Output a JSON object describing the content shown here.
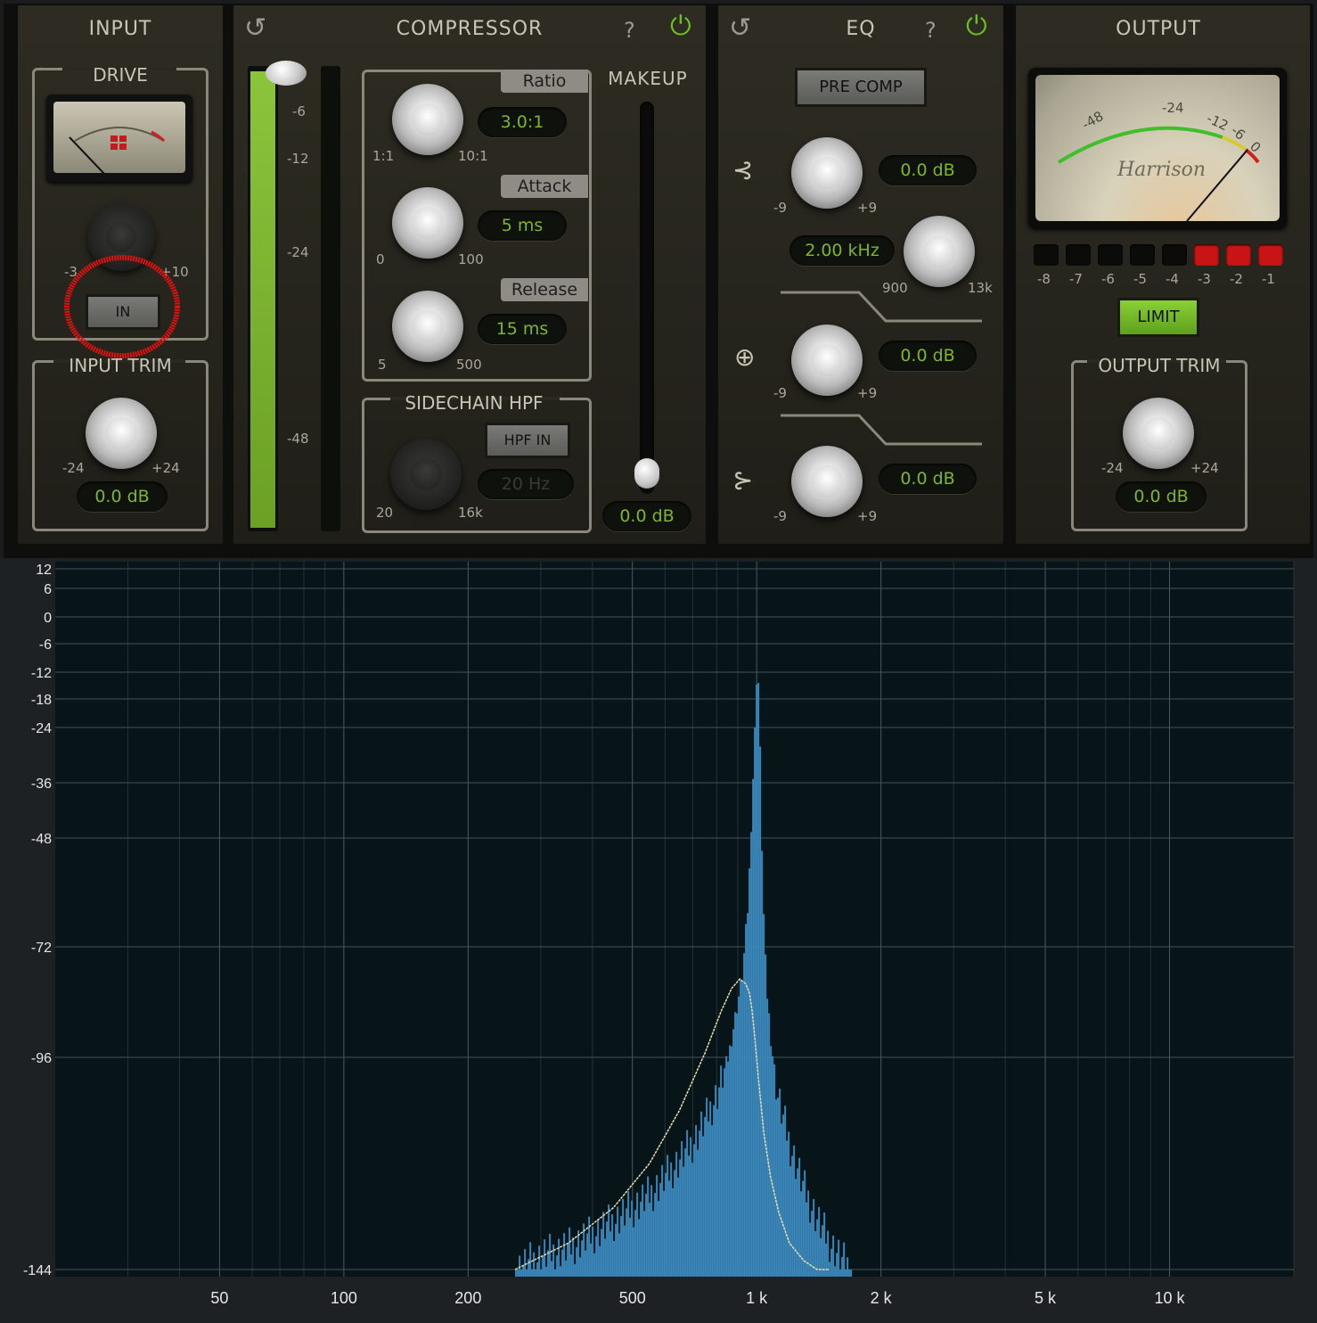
{
  "input": {
    "title": "INPUT",
    "drive_label": "DRIVE",
    "drive_min": "-3",
    "drive_max": "+10",
    "in_button": "IN",
    "trim_label": "INPUT TRIM",
    "trim_min": "-24",
    "trim_max": "+24",
    "trim_value": "0.0 dB"
  },
  "input_meter": {
    "scale": [
      "-6",
      "-12",
      "-24",
      "-48"
    ]
  },
  "compressor": {
    "title": "COMPRESSOR",
    "ratio_label": "Ratio",
    "ratio_value": "3.0:1",
    "ratio_min": "1:1",
    "ratio_max": "10:1",
    "attack_label": "Attack",
    "attack_value": "5 ms",
    "attack_min": "0",
    "attack_max": "100",
    "release_label": "Release",
    "release_value": "15 ms",
    "release_min": "5",
    "release_max": "500",
    "sidechain_label": "SIDECHAIN HPF",
    "hpf_button": "HPF IN",
    "hpf_value": "20 Hz",
    "hpf_min": "20",
    "hpf_max": "16k",
    "makeup_label": "MAKEUP",
    "makeup_value": "0.0 dB"
  },
  "eq": {
    "title": "EQ",
    "pre_comp_button": "PRE COMP",
    "band1_value": "0.0 dB",
    "band1_min": "-9",
    "band1_max": "+9",
    "freq_value": "2.00 kHz",
    "freq_min": "900",
    "freq_max": "13k",
    "band2_value": "0.0 dB",
    "band2_min": "-9",
    "band2_max": "+9",
    "band3_value": "0.0 dB",
    "band3_min": "-9",
    "band3_max": "+9"
  },
  "output": {
    "title": "OUTPUT",
    "vu_labels": [
      "-48",
      "-24",
      "-12",
      "-6",
      "0"
    ],
    "brand": "Harrison",
    "gr_leds": [
      "-8",
      "-7",
      "-6",
      "-5",
      "-4",
      "-3",
      "-2",
      "-1"
    ],
    "limit_button": "LIMIT",
    "trim_label": "OUTPUT TRIM",
    "trim_min": "-24",
    "trim_max": "+24",
    "trim_value": "0.0 dB"
  },
  "colors": {
    "accent_green": "#7fb52a",
    "power_green": "#6bc020",
    "led_red": "#c81414",
    "spectrum_blue": "#3a86b8",
    "annotation_red": "#e01010"
  },
  "chart_data": {
    "type": "area",
    "x_scale": "log",
    "xlabel": "",
    "ylabel": "",
    "x_ticks": [
      "50",
      "100",
      "200",
      "500",
      "1 k",
      "2 k",
      "5 k",
      "10 k"
    ],
    "y_ticks": [
      "12",
      "6",
      "0",
      "-6",
      "-12",
      "-18",
      "-24",
      "-36",
      "-48",
      "-72",
      "-96",
      "-144"
    ],
    "xlim": [
      20,
      20000
    ],
    "ylim": [
      -144,
      12
    ],
    "grid": true,
    "series": [
      {
        "style": "bars",
        "color": "#3a86b8",
        "x": [
          260,
          300,
          350,
          400,
          450,
          500,
          550,
          600,
          650,
          700,
          750,
          800,
          850,
          880,
          920,
          950,
          970,
          985,
          995,
          1000,
          1005,
          1015,
          1030,
          1050,
          1080,
          1120,
          1200,
          1300,
          1400,
          1500,
          1600,
          1700
        ],
        "y": [
          -144,
          -141,
          -139,
          -136,
          -133,
          -130,
          -127,
          -123,
          -119,
          -115,
          -110,
          -104,
          -96,
          -88,
          -78,
          -62,
          -40,
          -25,
          -13,
          -6,
          -15,
          -30,
          -60,
          -80,
          -93,
          -105,
          -116,
          -126,
          -133,
          -138,
          -142,
          -144
        ]
      },
      {
        "style": "line",
        "color": "#e9ddb0",
        "x": [
          260,
          350,
          450,
          550,
          650,
          750,
          820,
          870,
          910,
          940,
          960,
          975,
          990,
          1010,
          1040,
          1080,
          1130,
          1200,
          1300,
          1400,
          1500
        ],
        "y": [
          -144,
          -138,
          -130,
          -120,
          -108,
          -95,
          -86,
          -81,
          -79,
          -80,
          -82,
          -86,
          -92,
          -101,
          -113,
          -123,
          -131,
          -138,
          -142,
          -144,
          -145
        ]
      }
    ]
  }
}
